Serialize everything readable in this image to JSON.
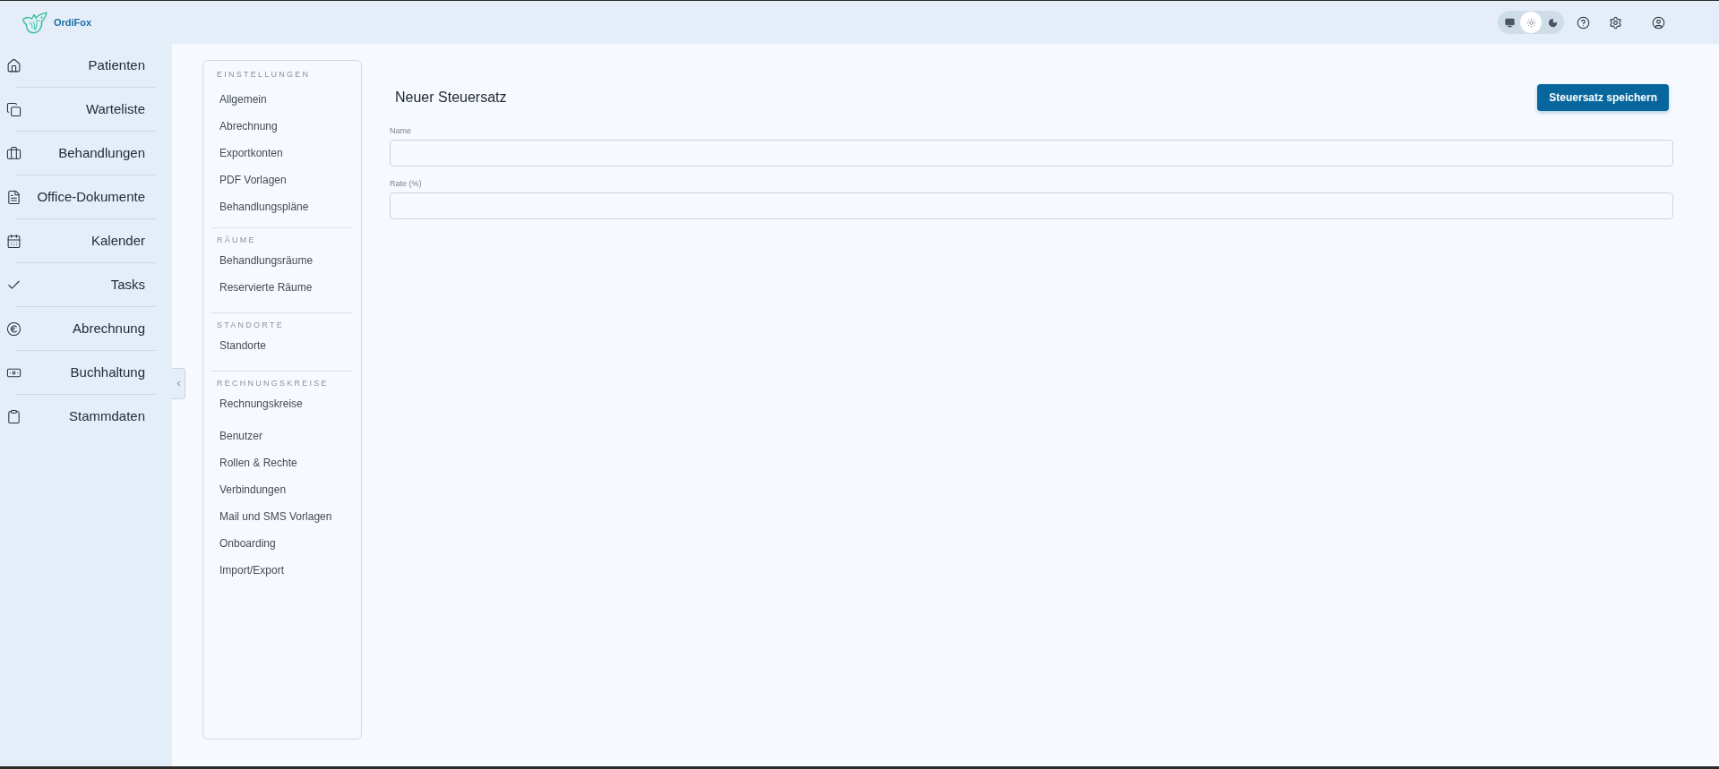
{
  "header": {
    "brand": "OrdiFox",
    "theme_switcher": [
      {
        "selected": false
      },
      {
        "selected": true
      },
      {
        "selected": false
      }
    ]
  },
  "sidebar": {
    "items": [
      {
        "label": "Patienten"
      },
      {
        "label": "Warteliste"
      },
      {
        "label": "Behandlungen"
      },
      {
        "label": "Office-Dokumente"
      },
      {
        "label": "Kalender"
      },
      {
        "label": "Tasks"
      },
      {
        "label": "Abrechnung"
      },
      {
        "label": "Buchhaltung"
      },
      {
        "label": "Stammdaten"
      }
    ]
  },
  "settings_menu": {
    "sections": [
      {
        "heading": "EINSTELLUNGEN",
        "items": [
          "Allgemein",
          "Abrechnung",
          "Exportkonten",
          "PDF Vorlagen",
          "Behandlungspläne"
        ]
      },
      {
        "heading": "RÄUME",
        "items": [
          "Behandlungsräume",
          "Reservierte Räume"
        ]
      },
      {
        "heading": "STANDORTE",
        "items": [
          "Standorte"
        ]
      },
      {
        "heading": "RECHNUNGSKREISE",
        "items": [
          "Rechnungskreise"
        ]
      },
      {
        "items": [
          "Benutzer",
          "Rollen & Rechte",
          "Verbindungen",
          "Mail und SMS Vorlagen",
          "Onboarding",
          "Import/Export"
        ]
      }
    ]
  },
  "form": {
    "title": "Neuer Steuersatz",
    "save_button": "Steuersatz speichern",
    "fields": [
      {
        "label": "Name"
      },
      {
        "label": "Rate (%)"
      }
    ]
  }
}
